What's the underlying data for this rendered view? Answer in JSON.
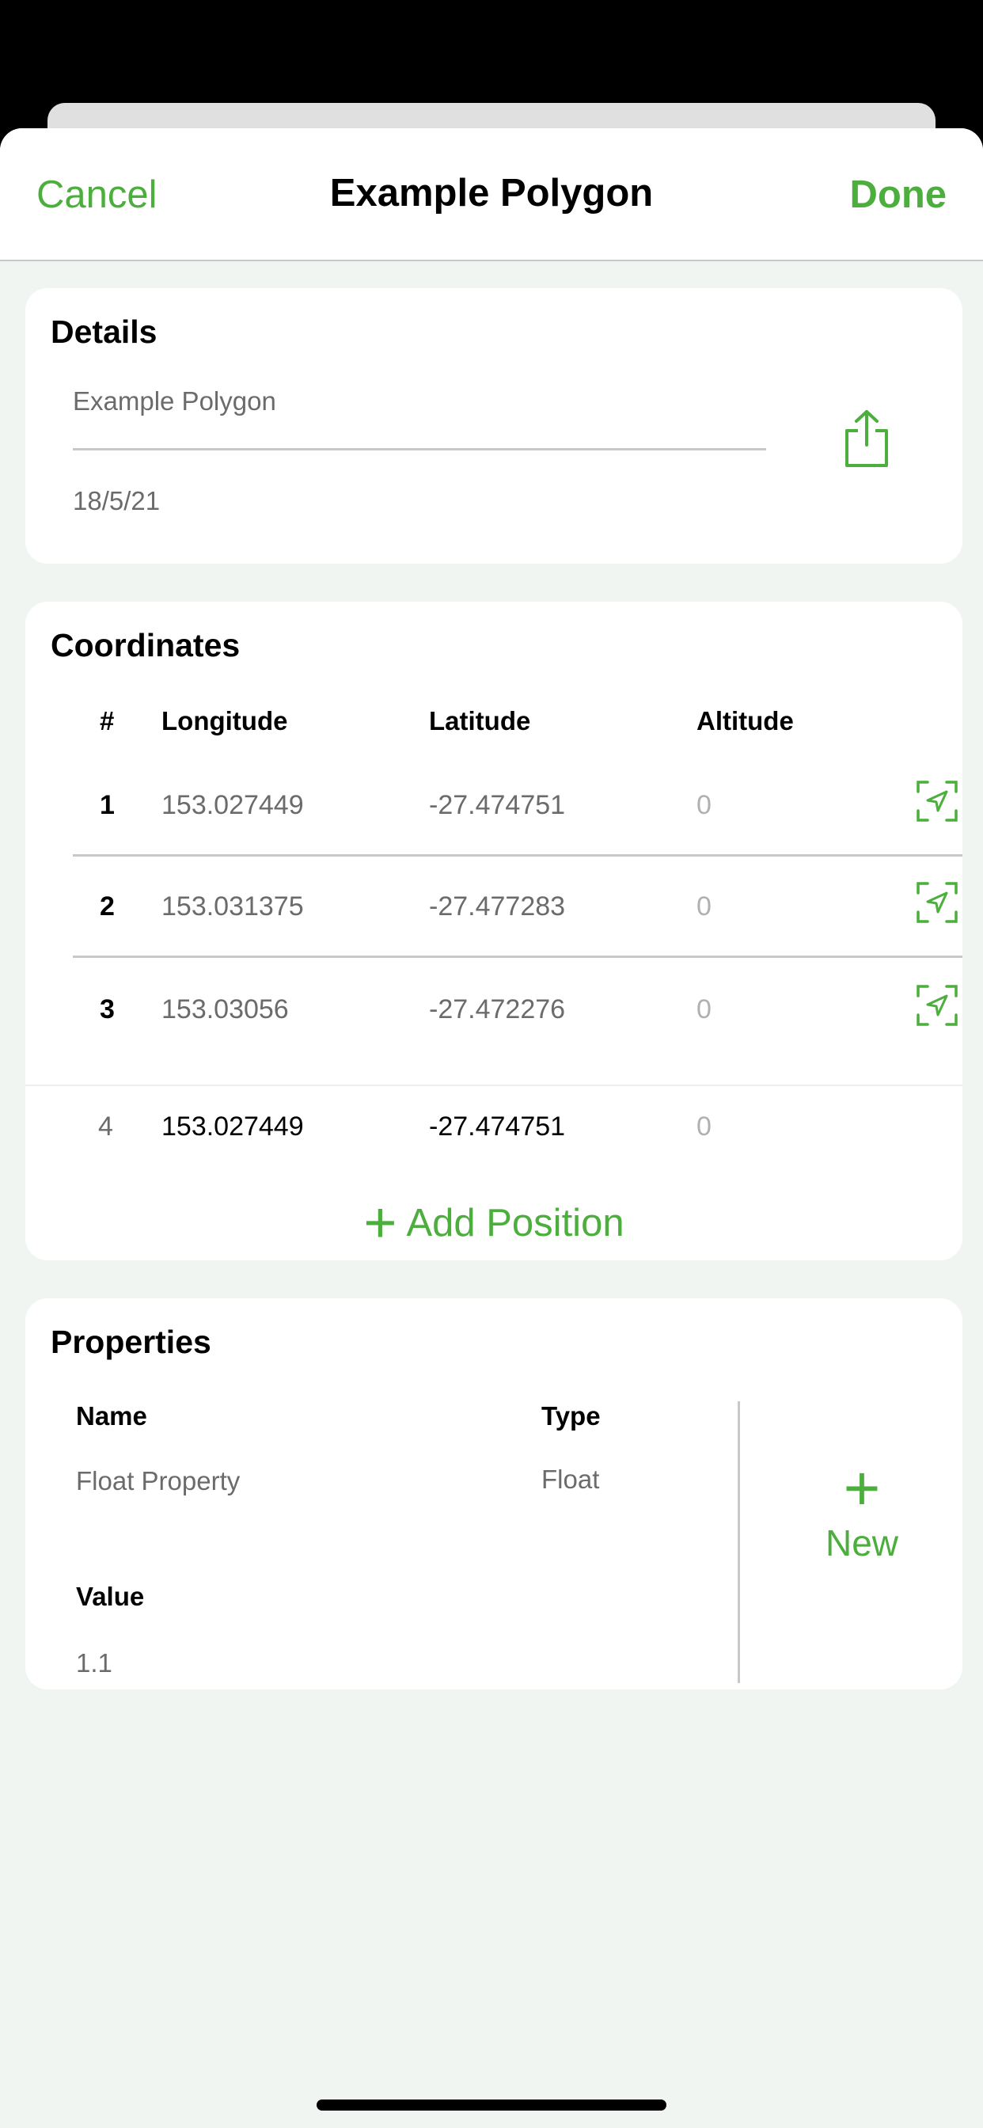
{
  "nav": {
    "cancel": "Cancel",
    "title": "Example Polygon",
    "done": "Done"
  },
  "details": {
    "title": "Details",
    "name": "Example Polygon",
    "date": "18/5/21"
  },
  "coordinates": {
    "title": "Coordinates",
    "headers": {
      "num": "#",
      "lon": "Longitude",
      "lat": "Latitude",
      "alt": "Altitude"
    },
    "rows": [
      {
        "num": "1",
        "lon": "153.027449",
        "lat": "-27.474751",
        "alt": "0"
      },
      {
        "num": "2",
        "lon": "153.031375",
        "lat": "-27.477283",
        "alt": "0"
      },
      {
        "num": "3",
        "lon": "153.03056",
        "lat": "-27.472276",
        "alt": "0"
      },
      {
        "num": "4",
        "lon": "153.027449",
        "lat": "-27.474751",
        "alt": "0"
      }
    ],
    "add_label": "Add Position",
    "add_symbol": "+"
  },
  "properties": {
    "title": "Properties",
    "name_label": "Name",
    "type_label": "Type",
    "value_label": "Value",
    "name": "Float Property",
    "type": "Float",
    "value": "1.1",
    "new_label": "New",
    "new_symbol": "+"
  },
  "colors": {
    "accent": "#4cae3c",
    "background": "#f0f5f2"
  }
}
